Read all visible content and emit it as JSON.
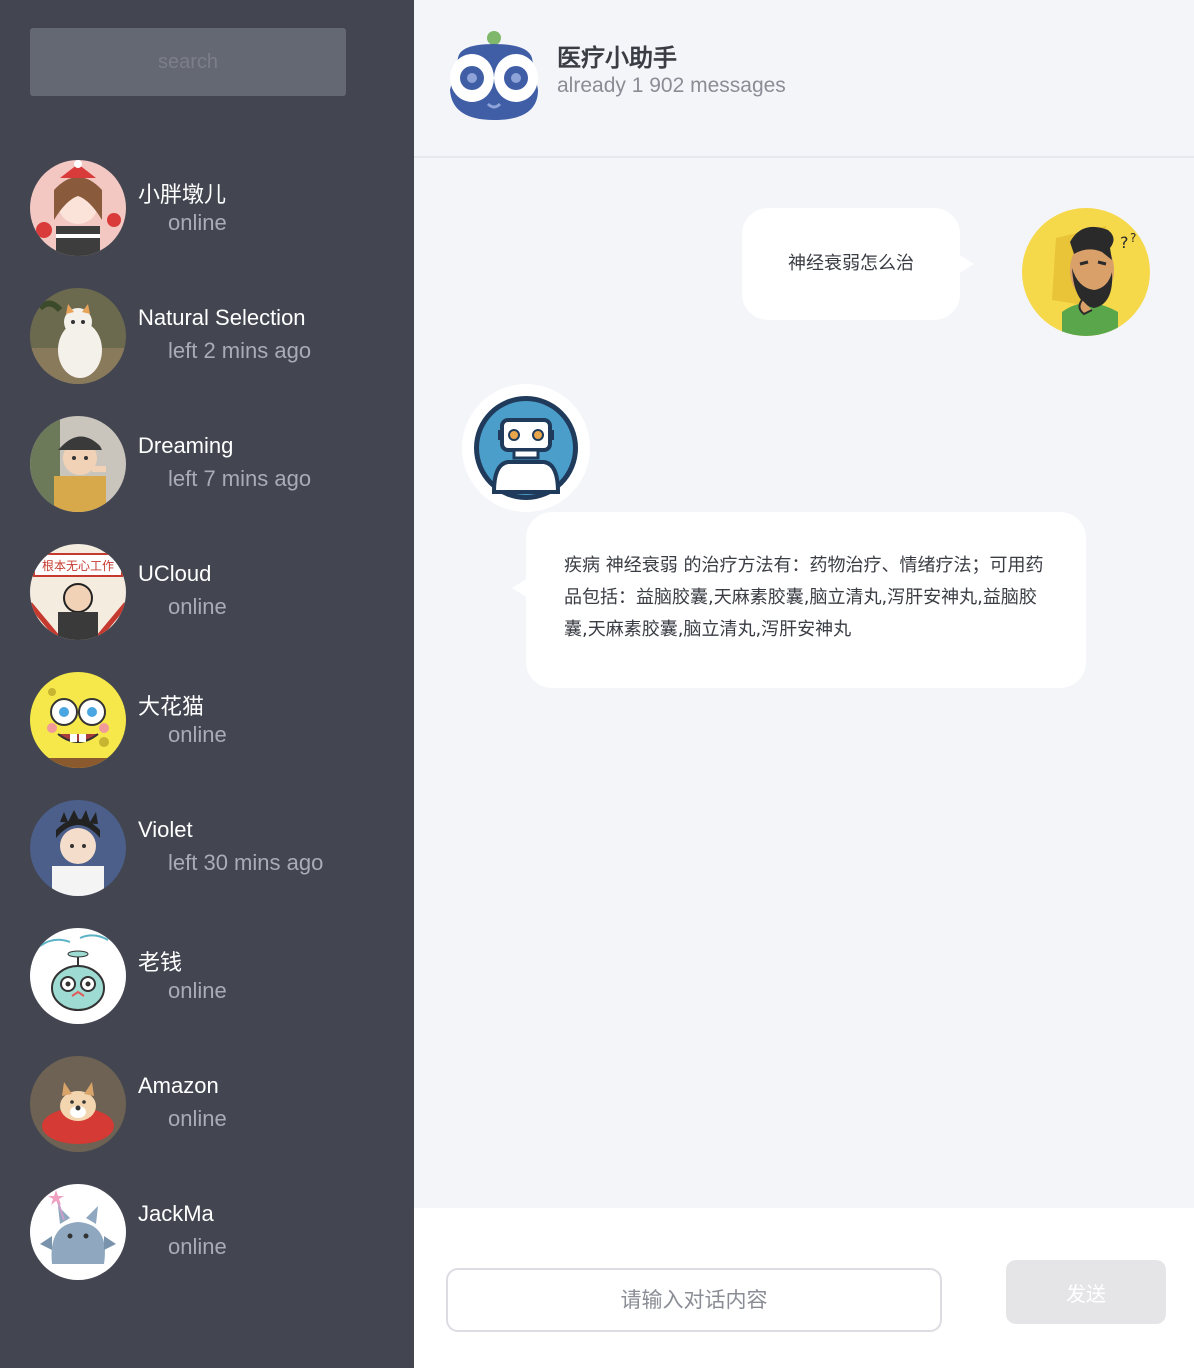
{
  "sidebar": {
    "search_placeholder": "search",
    "contacts": [
      {
        "name": "小胖墩儿",
        "status": "online"
      },
      {
        "name": "Natural Selection",
        "status": "left 2 mins ago"
      },
      {
        "name": "Dreaming",
        "status": "left 7 mins ago"
      },
      {
        "name": "UCloud",
        "status": "online"
      },
      {
        "name": "大花猫",
        "status": "online"
      },
      {
        "name": "Violet",
        "status": "left 30 mins ago"
      },
      {
        "name": "老钱",
        "status": "online"
      },
      {
        "name": "Amazon",
        "status": "online"
      },
      {
        "name": "JackMa",
        "status": "online"
      }
    ]
  },
  "header": {
    "title": "医疗小助手",
    "subtitle": "already 1 902 messages",
    "logo_icon": "robot-eyes-icon"
  },
  "messages": [
    {
      "from": "user",
      "text": "神经衰弱怎么治"
    },
    {
      "from": "bot",
      "text": "疾病 神经衰弱 的治疗方法有：药物治疗、情绪疗法；可用药品包括：益脑胶囊,天麻素胶囊,脑立清丸,泻肝安神丸,益脑胶囊,天麻素胶囊,脑立清丸,泻肝安神丸"
    }
  ],
  "composer": {
    "placeholder": "请输入对话内容",
    "value": "",
    "send_label": "发送"
  },
  "colors": {
    "sidebar_bg": "#434651",
    "main_bg": "#f4f5f9",
    "bubble_bg": "#ffffff",
    "send_disabled": "#e5e5e8"
  }
}
